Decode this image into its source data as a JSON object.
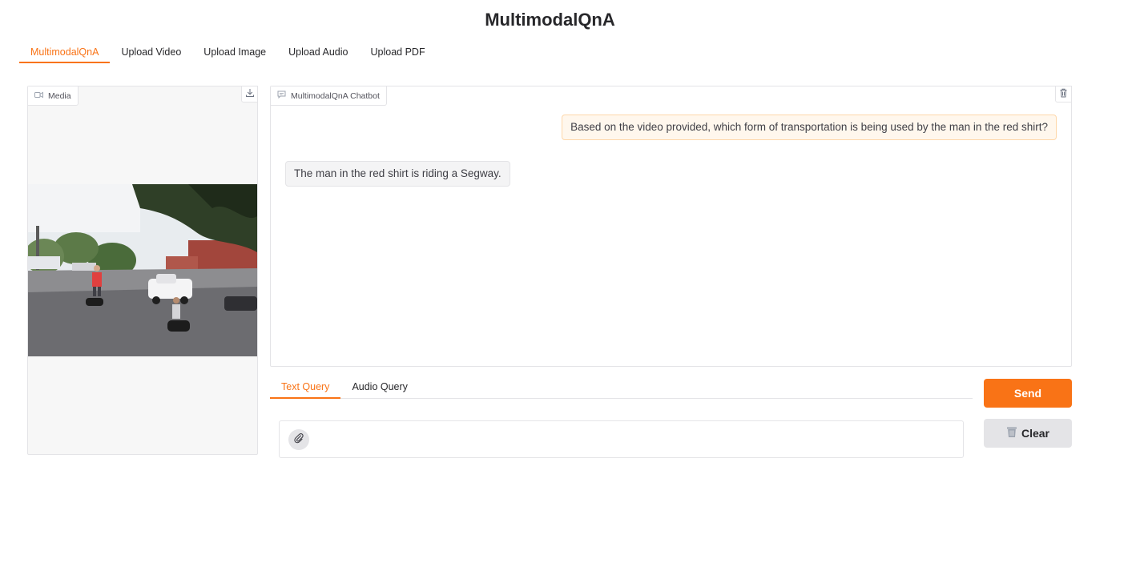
{
  "app": {
    "title": "MultimodalQnA"
  },
  "main_tabs": [
    {
      "label": "MultimodalQnA",
      "active": true
    },
    {
      "label": "Upload Video",
      "active": false
    },
    {
      "label": "Upload Image",
      "active": false
    },
    {
      "label": "Upload Audio",
      "active": false
    },
    {
      "label": "Upload PDF",
      "active": false
    }
  ],
  "media": {
    "label": "Media",
    "label_icon": "video-camera-icon",
    "download_icon": "download-icon",
    "video_description": "street scene with people riding Segways, man in red shirt"
  },
  "chatbot": {
    "label": "MultimodalQnA Chatbot",
    "label_icon": "chat-icon",
    "clear_icon": "trash-icon",
    "messages": [
      {
        "role": "user",
        "text": "Based on the video provided, which form of transportation is being used by the man in the red shirt?"
      },
      {
        "role": "bot",
        "text": "The man in the red shirt is riding a Segway."
      }
    ]
  },
  "query_tabs": [
    {
      "label": "Text Query",
      "active": true
    },
    {
      "label": "Audio Query",
      "active": false
    }
  ],
  "text_input": {
    "value": "",
    "placeholder": "",
    "attach_icon": "paperclip-icon"
  },
  "buttons": {
    "send": "Send",
    "clear": "Clear",
    "clear_icon": "trash-icon"
  },
  "colors": {
    "accent": "#f97316",
    "user_bubble": "#fff7ed",
    "bot_bubble": "#f4f4f5",
    "clear_bg": "#e4e4e7"
  }
}
